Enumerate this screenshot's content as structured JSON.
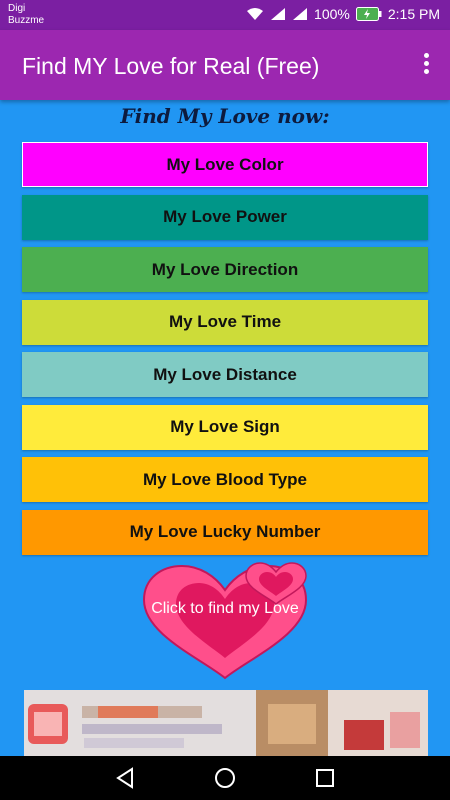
{
  "status_bar": {
    "carrier_line1": "Digi",
    "carrier_line2": "Buzzme",
    "battery": "100%",
    "time": "2:15 PM"
  },
  "app_bar": {
    "title": "Find MY Love for Real (Free)",
    "menu_icon": "overflow-menu-icon"
  },
  "subtitle": "Find My Love now:",
  "menu": [
    {
      "label": "My Love Color",
      "color": "#ff00ff"
    },
    {
      "label": "My Love Power",
      "color": "#009688"
    },
    {
      "label": "My Love Direction",
      "color": "#4caf50"
    },
    {
      "label": "My Love Time",
      "color": "#cddc39"
    },
    {
      "label": "My Love Distance",
      "color": "#80cbc4"
    },
    {
      "label": "My Love Sign",
      "color": "#ffeb3b"
    },
    {
      "label": "My Love Blood Type",
      "color": "#ffc107"
    },
    {
      "label": "My Love Lucky Number",
      "color": "#ff9800"
    }
  ],
  "find_button": {
    "label": "Click to find my Love",
    "icon": "heart-icon"
  },
  "nav_bar": {
    "back_icon": "back-triangle-icon",
    "home_icon": "home-circle-icon",
    "recents_icon": "recents-square-icon"
  },
  "colors": {
    "background": "#2196f3",
    "app_bar": "#9c27b0",
    "status_bar": "#7b1fa2",
    "heart_outer": "#ff4f8b",
    "heart_inner": "#e0185f"
  }
}
